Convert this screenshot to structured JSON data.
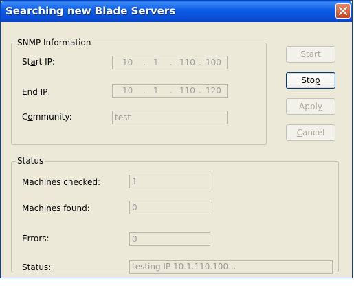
{
  "window": {
    "title": "Searching new Blade Servers"
  },
  "snmp": {
    "group_label": "SNMP Information",
    "start_ip": {
      "label_before": "St",
      "label_accel": "a",
      "label_after": "rt IP:",
      "octets": [
        "10",
        "1",
        "110",
        "100"
      ]
    },
    "end_ip": {
      "label_before": "",
      "label_accel": "E",
      "label_after": "nd IP:",
      "octets": [
        "10",
        "1",
        "110",
        "120"
      ]
    },
    "community": {
      "label_before": "C",
      "label_accel": "o",
      "label_after": "mmunity:",
      "value": "test"
    }
  },
  "buttons": {
    "start": {
      "before": "",
      "accel": "S",
      "after": "tart"
    },
    "stop": {
      "before": "Sto",
      "accel": "p",
      "after": ""
    },
    "apply": {
      "before": "Appl",
      "accel": "y",
      "after": ""
    },
    "cancel": {
      "before": "",
      "accel": "C",
      "after": "ancel"
    }
  },
  "status": {
    "group_label": "Status",
    "machines_checked": {
      "label": "Machines checked:",
      "value": "1"
    },
    "machines_found": {
      "label": "Machines found:",
      "value": "0"
    },
    "errors": {
      "label": "Errors:",
      "value": "0"
    },
    "status": {
      "label": "Status:",
      "value": "testing IP 10.1.110.100..."
    }
  }
}
